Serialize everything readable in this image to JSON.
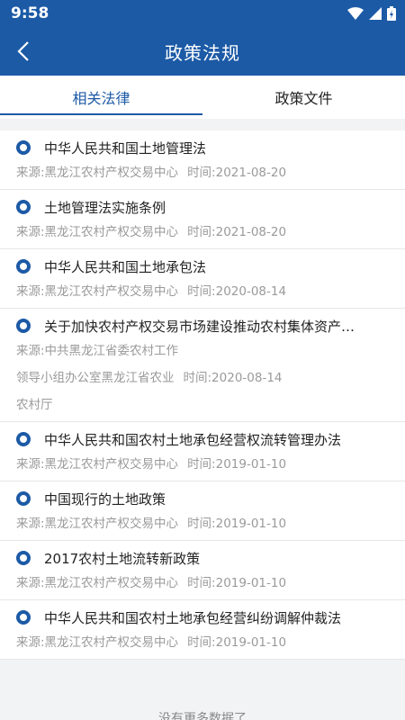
{
  "status": {
    "time": "9:58"
  },
  "header": {
    "title": "政策法规",
    "back_icon": "back-arrow-icon"
  },
  "tabs": [
    {
      "label": "相关法律",
      "active": true
    },
    {
      "label": "政策文件",
      "active": false
    }
  ],
  "items": [
    {
      "title": "中华人民共和国土地管理法",
      "source": "来源:黑龙江农村产权交易中心",
      "time": "时间:2021-08-20"
    },
    {
      "title": "土地管理法实施条例",
      "source": "来源:黑龙江农村产权交易中心",
      "time": "时间:2021-08-20"
    },
    {
      "title": "中华人民共和国土地承包法",
      "source": "来源:黑龙江农村产权交易中心",
      "time": "时间:2020-08-14"
    },
    {
      "title": "关于加快农村产权交易市场建设推动农村集体资产…",
      "source_lines": [
        "来源:中共黑龙江省委农村工作",
        "领导小组办公室黑龙江省农业",
        "农村厅"
      ],
      "time": "时间:2020-08-14"
    },
    {
      "title": "中华人民共和国农村土地承包经营权流转管理办法",
      "source": "来源:黑龙江农村产权交易中心",
      "time": "时间:2019-01-10"
    },
    {
      "title": "中国现行的土地政策",
      "source": "来源:黑龙江农村产权交易中心",
      "time": "时间:2019-01-10"
    },
    {
      "title": "2017农村土地流转新政策",
      "source": "来源:黑龙江农村产权交易中心",
      "time": "时间:2019-01-10"
    },
    {
      "title": "中华人民共和国农村土地承包经营纠纷调解仲裁法",
      "source": "来源:黑龙江农村产权交易中心",
      "time": "时间:2019-01-10"
    }
  ],
  "footer": {
    "text": "没有更多数据了"
  },
  "colors": {
    "primary": "#1c5aa6",
    "meta_text": "#9a9a9a"
  }
}
